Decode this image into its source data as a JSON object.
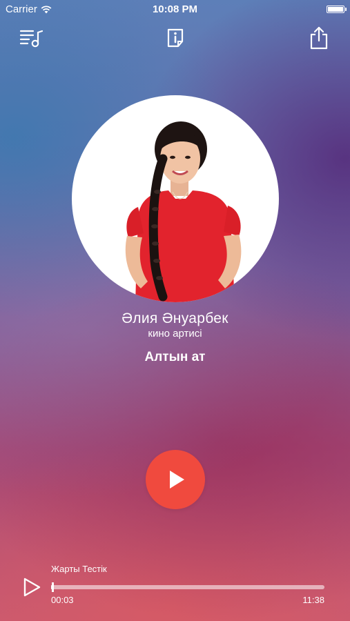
{
  "status_bar": {
    "carrier": "Carrier",
    "time": "10:08 PM"
  },
  "toolbar": {
    "left_icon": "playlist-music-icon",
    "center_icon": "info-icon",
    "right_icon": "share-icon"
  },
  "artist": {
    "name": "Әлия Әнуарбек",
    "role": "кино артисі"
  },
  "track": {
    "title": "Алтын ат"
  },
  "player": {
    "now_playing": "Жарты Тестік",
    "elapsed": "00:03",
    "total": "11:38",
    "progress": 0.004
  },
  "colors": {
    "play_button": "#f04a3e",
    "text": "#ffffff"
  }
}
